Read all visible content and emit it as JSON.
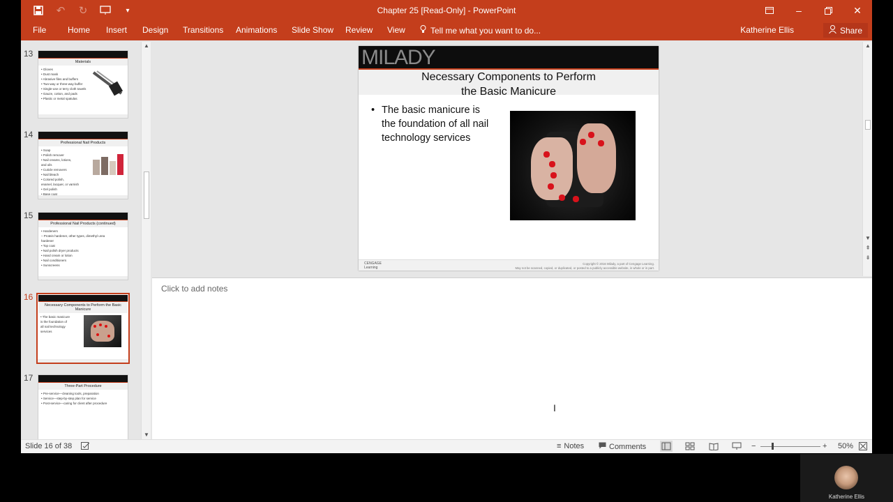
{
  "window": {
    "title": "Chapter 25 [Read-Only] - PowerPoint"
  },
  "qat": {
    "save": "save-icon",
    "undo": "undo-icon",
    "redo": "redo-icon",
    "present": "slideshow-icon",
    "more": "customize-icon"
  },
  "ribbon": {
    "tabs": [
      "File",
      "Home",
      "Insert",
      "Design",
      "Transitions",
      "Animations",
      "Slide Show",
      "Review",
      "View"
    ],
    "tell_me": "Tell me what you want to do...",
    "user": "Katherine Ellis",
    "share": "Share"
  },
  "thumbnails": [
    {
      "number": "13",
      "title": "Materials",
      "body": "• Gloves\n• Dust mask\n• Abrasive files and buffers\n• Two-way or three-way buffer\n• Single-use or terry cloth towels\n• Gauze, cotton, and pads\n• Plastic or metal spatulas"
    },
    {
      "number": "14",
      "title": "Professional Nail Products",
      "body": "• Soap\n• Polish remover\n• Nail creams, lotions,\n  and oils\n• Cuticle removers\n• Nail bleach\n• Colored polish,\n  enamel, lacquer, or varnish\n• Gel polish\n• Base coat"
    },
    {
      "number": "15",
      "title": "Professional Nail Products (continued)",
      "body": "• Hardeners\n  – Protein hardener, other types, dimethyl urea\n    hardener\n• Top coat\n• Nail polish dryer products\n• Hand cream or lotion\n• Nail conditioners\n• Sunscreens"
    },
    {
      "number": "16",
      "title": "Necessary Components to Perform the Basic Manicure",
      "body": "• The basic manicure\n  is the foundation of\n  all nail technology\n  services"
    },
    {
      "number": "17",
      "title": "Three-Part Procedure",
      "body": "• Pre-service—cleaning tools, preparation\n• Service—step-by-step plan for service\n• Post-service—caring for client after procedure"
    }
  ],
  "slide": {
    "brand": "MILADY",
    "title_line1": "Necessary Components to Perform",
    "title_line2": "the Basic Manicure",
    "bullet_marker": "•",
    "bullet_text": "The basic manicure is the foundation of all nail technology services",
    "footer_logo": "CENGAGE\nLearning",
    "footer_copyright": "Copyright © 2016 Milady, a part of Cengage Learning.\nMay not be scanned, copied, or duplicated, or posted to a publicly accessible website, in whole or in part."
  },
  "notes": {
    "placeholder": "Click to add notes"
  },
  "status": {
    "slide_info": "Slide 16 of 38",
    "notes": "Notes",
    "comments": "Comments",
    "zoom": "50%"
  },
  "webcam": {
    "name": "Katherine Ellis"
  },
  "colors": {
    "accent": "#c43e1c"
  }
}
